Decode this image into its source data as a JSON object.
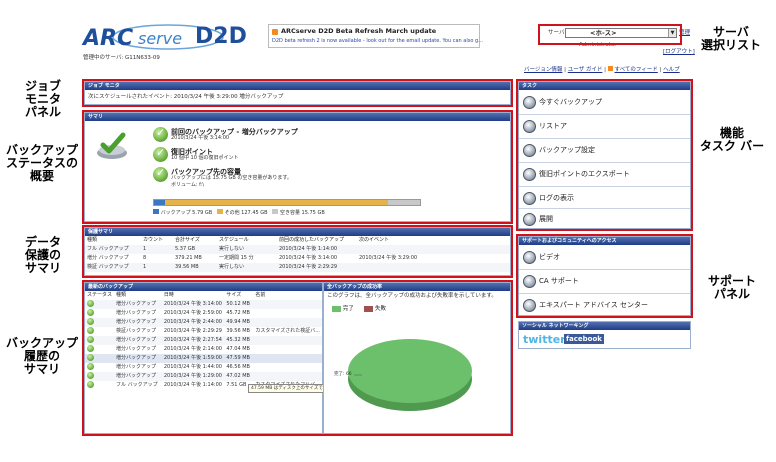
{
  "callouts": {
    "server_select": "サーバ\n選択リスト",
    "job_monitor": "ジョブ\nモニタ\nパネル",
    "backup_status": "バックアップ\nステータスの\n概要",
    "data_protection": "データ\n保護の\nサマリ",
    "backup_history": "バックアップ\n履歴の\nサマリ",
    "task_bar": "機能\nタスク バー",
    "support_panel": "サポート\nパネル"
  },
  "header": {
    "logo_text_arc": "ARC",
    "logo_text_serve": "serve",
    "logo_text_d2d": "D2D",
    "managed_server": "管理中のサーバ: G11N633-09",
    "news_title": "ARCserve D2D Beta Refresh March update",
    "news_body": "D2D beta refresh 2 is now available - look out for the email update. You can also g...",
    "server_label": "サーバ:",
    "server_value": "<ホ-ス>",
    "server_admin_link": "管理",
    "admin_name": "Administrator",
    "logout": "[ログアウト]",
    "links": [
      "バージョン情報",
      "ユーザ ガイド",
      "すべてのフィード",
      "ヘルプ"
    ]
  },
  "job_monitor": {
    "title": "ジョブ モニタ",
    "next_event": "次にスケジュールされたイベント: 2010/3/24 午後 3:29:00  増分バックアップ"
  },
  "summary": {
    "title": "サマリ",
    "items": [
      {
        "title": "前回のバックアップ - 増分バックアップ",
        "detail": "2010/3/24 午後 3:14:00"
      },
      {
        "title": "復旧ポイント",
        "detail": "10 個中 10 個の復旧ポイント"
      },
      {
        "title": "バックアップ先の容量",
        "detail": "バックアップには 15.75 GB の空き容量があります。",
        "detail2": "ボリューム: f:\\"
      }
    ],
    "storage": {
      "backup_fraction": 0.041,
      "other_fraction": 0.84,
      "free_fraction": 0.119
    },
    "legend": [
      "バックアップ 5.79 GB",
      "その他 127.45 GB",
      "空き容量 15.75 GB"
    ],
    "colors": {
      "backup": "#3a78c4",
      "other": "#e6b24a",
      "free": "#c8c8c8"
    }
  },
  "protection": {
    "title": "保護サマリ",
    "headers": [
      "種類",
      "カウント",
      "合計サイズ",
      "スケジュール",
      "前回の成功したバックアップ",
      "次のイベント"
    ],
    "rows": [
      [
        "フル バックアップ",
        "1",
        "5.37 GB",
        "実行しない",
        "2010/3/24 午後 1:14:00",
        ""
      ],
      [
        "増分 バックアップ",
        "8",
        "379.21 MB",
        "一定期間 15 分",
        "2010/3/24 午後 3:14:00",
        "2010/3/24 午後 3:29:00"
      ],
      [
        "検証 バックアップ",
        "1",
        "39.56 MB",
        "実行しない",
        "2010/3/24 午後 2:29:29",
        ""
      ]
    ]
  },
  "history": {
    "title": "最新のバックアップ",
    "headers": [
      "ステータス",
      "種類",
      "日時",
      "サイズ",
      "名前"
    ],
    "rows": [
      [
        "増分バックアップ",
        "2010/3/24 午後 3:14:00",
        "50.12 MB",
        ""
      ],
      [
        "増分バックアップ",
        "2010/3/24 午後 2:59:00",
        "45.72 MB",
        ""
      ],
      [
        "増分バックアップ",
        "2010/3/24 午後 2:44:00",
        "49.94 MB",
        ""
      ],
      [
        "検証バックアップ",
        "2010/3/24 午後 2:29:29",
        "39.56 MB",
        "カスタマイズされた検証バ..."
      ],
      [
        "増分バックアップ",
        "2010/3/24 午後 2:27:54",
        "45.32 MB",
        ""
      ],
      [
        "増分バックアップ",
        "2010/3/24 午後 2:14:00",
        "47.04 MB",
        ""
      ],
      [
        "増分バックアップ",
        "2010/3/24 午後 1:59:00",
        "47.59 MB",
        ""
      ],
      [
        "増分バックアップ",
        "2010/3/24 午後 1:44:00",
        "46.56 MB",
        ""
      ],
      [
        "増分バックアップ",
        "2010/3/24 午後 1:29:00",
        "47.02 MB",
        ""
      ],
      [
        "フル バックアップ",
        "2010/3/24 午後 1:14:00",
        "7.51 GB",
        "カスタマイズされたフルバ..."
      ]
    ],
    "tooltip": "47.59 MB はディスク上のサイズです"
  },
  "pie_panel": {
    "title": "全バックアップの成功率",
    "description": "このグラフは、全バックアップの成功および失敗率を示しています。",
    "legend_complete": "完了",
    "legend_failed": "失敗",
    "slice_label": "完了: 66",
    "colors": {
      "complete": "#6cc06c",
      "failed": "#a05050"
    }
  },
  "tasks": {
    "title": "タスク",
    "items": [
      "今すぐバックアップ",
      "リストア",
      "バックアップ設定",
      "復旧ポイントのエクスポート",
      "ログの表示",
      "展開"
    ]
  },
  "support": {
    "title": "サポートおよびコミュニティへのアクセス",
    "items": [
      "ビデオ",
      "CA サポート",
      "エキスパート アドバイス センター"
    ]
  },
  "social": {
    "title": "ソーシャル ネットワーキング",
    "twitter": "twitter",
    "facebook": "facebook"
  }
}
